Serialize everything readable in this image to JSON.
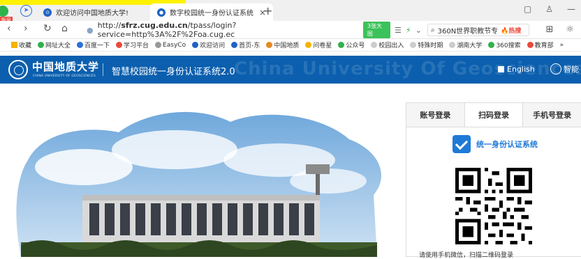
{
  "browser": {
    "tabs": [
      {
        "label": "欢迎访问中国地质大学!"
      },
      {
        "label": "数字校园统一身份认证系统",
        "close": "×"
      }
    ],
    "new_tab": "+",
    "badge": "账号",
    "url_prefix": "http://",
    "url_host": "sfrz.cug.edu.cn",
    "url_path": "/tpass/login?service=http%3A%2F%2Foa.cug.ec",
    "image_chip": "3张大图",
    "search_text": "360N世界职教节专",
    "search_hot": "🔥热搜",
    "bookmarks": [
      "收藏",
      "网址大全",
      "百度一下",
      "学习平台",
      "EasyCo",
      "欢迎访问",
      "首页-东",
      "中国地质",
      "问卷星",
      "公众号",
      "校园出入",
      "特殊时期",
      "湖南大学",
      "360搜索",
      "教育部",
      "»"
    ]
  },
  "header": {
    "logo_cn": "中国地质大学",
    "logo_en": "CHINA UNIVERSITY OF GEOSCIENCES",
    "system_title": "智慧校园统一身份认证系统2.0",
    "watermark": "China University Of Geosciences",
    "lang": "English",
    "smart": "智能"
  },
  "login": {
    "tabs": [
      "账号登录",
      "扫码登录",
      "手机号登录"
    ],
    "active_tab": 1,
    "brand_text": "统一身份认证系统",
    "qr_hint": "请使用手机微信，扫描二维码登录"
  },
  "colors": {
    "header_bg": "#0b5fae",
    "accent": "#1f7ad6"
  }
}
